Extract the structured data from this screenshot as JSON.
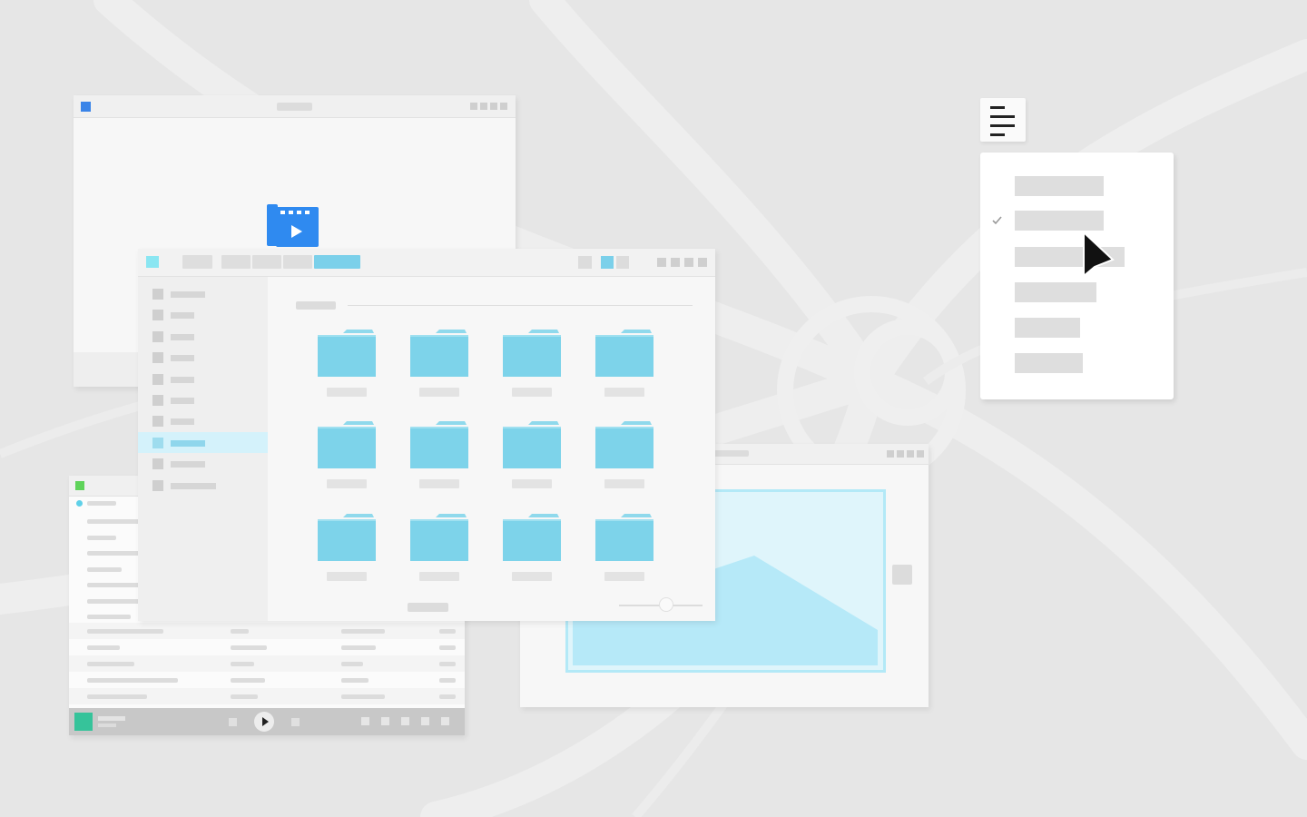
{
  "desktop": {
    "background_color": "#e6e6e6",
    "swirl_color": "#ededed"
  },
  "video_window": {
    "app_icon": "video-player-icon",
    "accent_color": "#2f8af0"
  },
  "file_manager": {
    "sidebar": {
      "items": [
        {
          "icon": "folder-icon",
          "selected": false
        },
        {
          "icon": "folder-icon",
          "selected": false
        },
        {
          "icon": "folder-icon",
          "selected": false
        },
        {
          "icon": "folder-icon",
          "selected": false
        },
        {
          "icon": "folder-icon",
          "selected": false
        },
        {
          "icon": "folder-icon",
          "selected": false
        },
        {
          "icon": "folder-icon",
          "selected": false
        },
        {
          "icon": "folder-icon",
          "selected": true
        },
        {
          "icon": "folder-icon",
          "selected": false
        },
        {
          "icon": "folder-icon",
          "selected": false
        }
      ]
    },
    "folder_count": 12,
    "folder_color": "#7dd3ea",
    "accent_color": "#7bd0ea",
    "zoom_slider_level": 0.57
  },
  "music_player": {
    "accent_color": "#36c39a",
    "status_dot_color": "#5fd0e8"
  },
  "image_viewer": {
    "image_icon": "image-placeholder-icon",
    "frame_color": "#b3e9f7"
  },
  "popup_menu": {
    "trigger_icon": "hamburger-menu-icon",
    "checked_item_index": 1,
    "item_count": 6
  },
  "cursor": {
    "icon": "mouse-pointer-icon"
  }
}
